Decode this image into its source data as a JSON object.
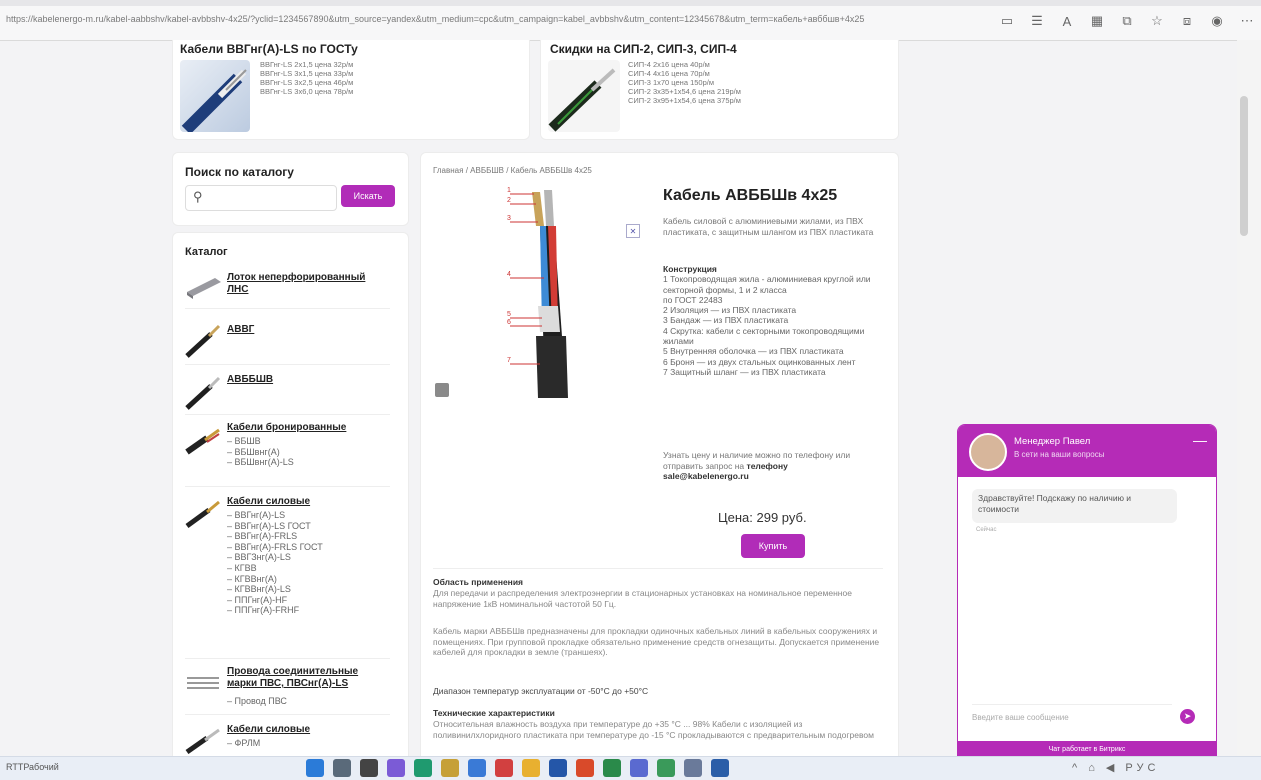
{
  "browser": {
    "url": "https://kabelenergo-m.ru/kabel-aabbshv/kabel-avbbshv-4x25/?yclid=1234567890&utm_source=yandex&utm_medium=cpc&utm_campaign=kabel_avbbshv&utm_content=12345678&utm_term=кабель+авббшв+4х25",
    "toolbar_icons": [
      "tab-search-icon",
      "reader-icon",
      "translate-icon",
      "apps-icon",
      "extension-icon",
      "favorites-icon",
      "collections-icon",
      "profile-icon",
      "menu-icon"
    ]
  },
  "promos": [
    {
      "title": "Кабели ВВГнг(А)-LS по ГОСТу",
      "lines": [
        "ВВГнг-LS 2х1,5 цена 32р/м",
        "ВВГнг-LS 3х1,5 цена 33р/м",
        "ВВГнг-LS 3х2,5 цена 46р/м",
        "ВВГнг-LS 3х6,0 цена 78р/м"
      ]
    },
    {
      "title": "Скидки на СИП-2, СИП-3, СИП-4",
      "lines": [
        "СИП-4 2х16 цена 40р/м",
        "СИП-4 4х16 цена 70р/м",
        "СИП-3 1х70 цена 150р/м",
        "СИП-2 3х35+1х54,6 цена 219р/м",
        "СИП-2 3х95+1х54,6 цена 375р/м"
      ]
    }
  ],
  "sidebar": {
    "search_title": "Поиск по каталогу",
    "search_placeholder": "",
    "search_button": "Искать",
    "catalog_title": "Каталог",
    "categories": [
      {
        "name": "Лоток неперфорированный ЛНС",
        "subs": []
      },
      {
        "name": "АВВГ",
        "subs": []
      },
      {
        "name": "АВББШВ",
        "subs": []
      },
      {
        "name": "Кабели бронированные",
        "subs": [
          "ВБШВ",
          "ВБШвнг(А)",
          "ВБШвнг(А)-LS"
        ]
      },
      {
        "name": "Кабели силовые",
        "subs": [
          "ВВГнг(А)-LS",
          "ВВГнг(А)-LS ГОСТ",
          "ВВГнг(А)-FRLS",
          "ВВГнг(А)-FRLS ГОСТ",
          "ВВГЗнг(А)-LS",
          "КГВВ",
          "КГВВнг(А)",
          "КГВВнг(А)-LS",
          "ППГнг(А)-HF",
          "ППГнг(А)-FRHF"
        ]
      },
      {
        "name": "Провода соединительные марки ПВС, ПВСнг(А)-LS",
        "subs": [
          "Провод ПВС"
        ]
      },
      {
        "name": "Кабели силовые",
        "subs": [
          "ФРЛМ"
        ]
      }
    ]
  },
  "product": {
    "breadcrumb": [
      "Главная",
      "АВББШВ",
      "Кабель АВББШв 4х25"
    ],
    "title": "Кабель АВББШв 4х25",
    "description": "Кабель силовой с алюминиевыми жилами, из ПВХ пластиката, с защитным шлангом из ПВХ пластиката",
    "construction_title": "Конструкция",
    "construction": [
      "1 Токопроводящая жила - алюминиевая круглой или секторной формы, 1 и 2 класса",
      "по ГОСТ 22483",
      "2 Изоляция — из ПВХ пластиката",
      "3 Бандаж — из ПВХ пластиката",
      "4 Скрутка: кабели с секторными токопроводящими жилами",
      "5 Внутренняя оболочка — из ПВХ пластиката",
      "6 Броня — из двух стальных оцинкованных лент",
      "7 Защитный шланг — из ПВХ пластиката"
    ],
    "contact": "Узнать цену и наличие можно по телефону или отправить запрос на",
    "contact_strong": "телефону",
    "email": "sale@kabelenergo.ru",
    "price": "Цена: 299 руб.",
    "buy_button": "Купить",
    "callouts": [
      "1",
      "2",
      "3",
      "4",
      "5",
      "6",
      "7"
    ]
  },
  "body": {
    "usage_title": "Область применения",
    "usage": "Для передачи и распределения электроэнергии в стационарных установках на номинальное переменное напряжение 1кВ номинальной частотой 50 Гц.",
    "para2": "Кабель марки АВББШв предназначены для прокладки одиночных кабельных линий в кабельных сооружениях и помещениях. При групповой прокладке обязательно применение средств огнезащиты. Допускается применение кабелей для прокладки в земле (траншеях).",
    "temp": "Диапазон температур эксплуатации от -50°С до +50°С",
    "tech_title": "Технические характеристики",
    "tech": "Относительная влажность воздуха при температуре до +35 °С ... 98% Кабели с изоляцией из поливинилхлоридного пластиката при температуре до -15 °С прокладываются с предварительным подогревом"
  },
  "chat": {
    "name": "Менеджер Павел",
    "status": "В сети на ваши вопросы",
    "message": "Здравствуйте! Подскажу по наличию и стоимости",
    "time": "Сейчас",
    "input_placeholder": "Введите ваше сообщение",
    "footer": "Чат работает в Битрикс"
  },
  "taskbar": {
    "left": "RTTРабочий",
    "right": "^ ⌂ ◀ РУС"
  },
  "colors": {
    "accent": "#b12cb8"
  }
}
